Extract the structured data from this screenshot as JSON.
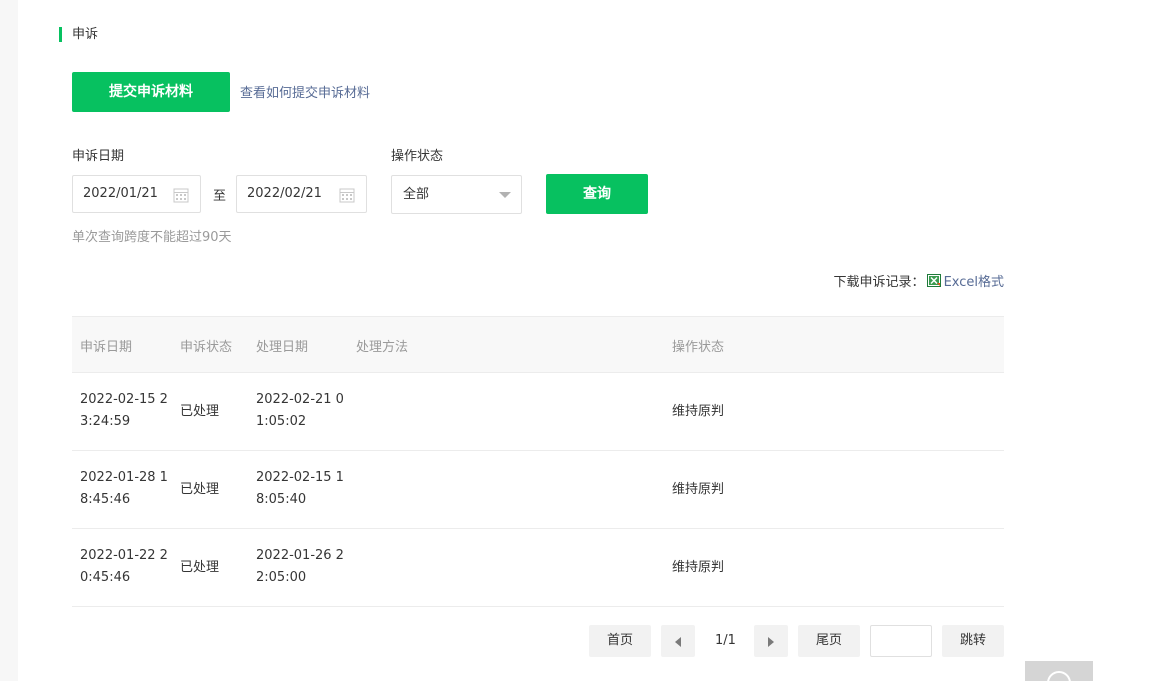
{
  "section": {
    "title": "申诉"
  },
  "actions": {
    "submit_label": "提交申诉材料",
    "howto_link": "查看如何提交申诉材料"
  },
  "filters": {
    "date_label": "申诉日期",
    "start_date": "2022/01/21",
    "to_label": "至",
    "end_date": "2022/02/21",
    "status_label": "操作状态",
    "status_value": "全部",
    "query_label": "查询",
    "hint": "单次查询跨度不能超过90天"
  },
  "download": {
    "label": "下载申诉记录：",
    "link": "Excel格式"
  },
  "table": {
    "headers": [
      "申诉日期",
      "申诉状态",
      "处理日期",
      "处理方法",
      "操作状态"
    ],
    "rows": [
      {
        "date": "2022-02-15 23:24:59",
        "status": "已处理",
        "process_date": "2022-02-21 01:05:02",
        "method": "",
        "op": "维持原判"
      },
      {
        "date": "2022-01-28 18:45:46",
        "status": "已处理",
        "process_date": "2022-02-15 18:05:40",
        "method": "",
        "op": "维持原判"
      },
      {
        "date": "2022-01-22 20:45:46",
        "status": "已处理",
        "process_date": "2022-01-26 22:05:00",
        "method": "",
        "op": "维持原判"
      }
    ]
  },
  "pager": {
    "first": "首页",
    "count": "1/1",
    "last": "尾页",
    "jump": "跳转",
    "page_input": ""
  },
  "colors": {
    "accent": "#07c160",
    "link": "#576b95"
  },
  "icons": {
    "calendar": "calendar-icon",
    "excel": "excel-icon",
    "prev": "prev-page-icon",
    "next": "next-page-icon"
  }
}
